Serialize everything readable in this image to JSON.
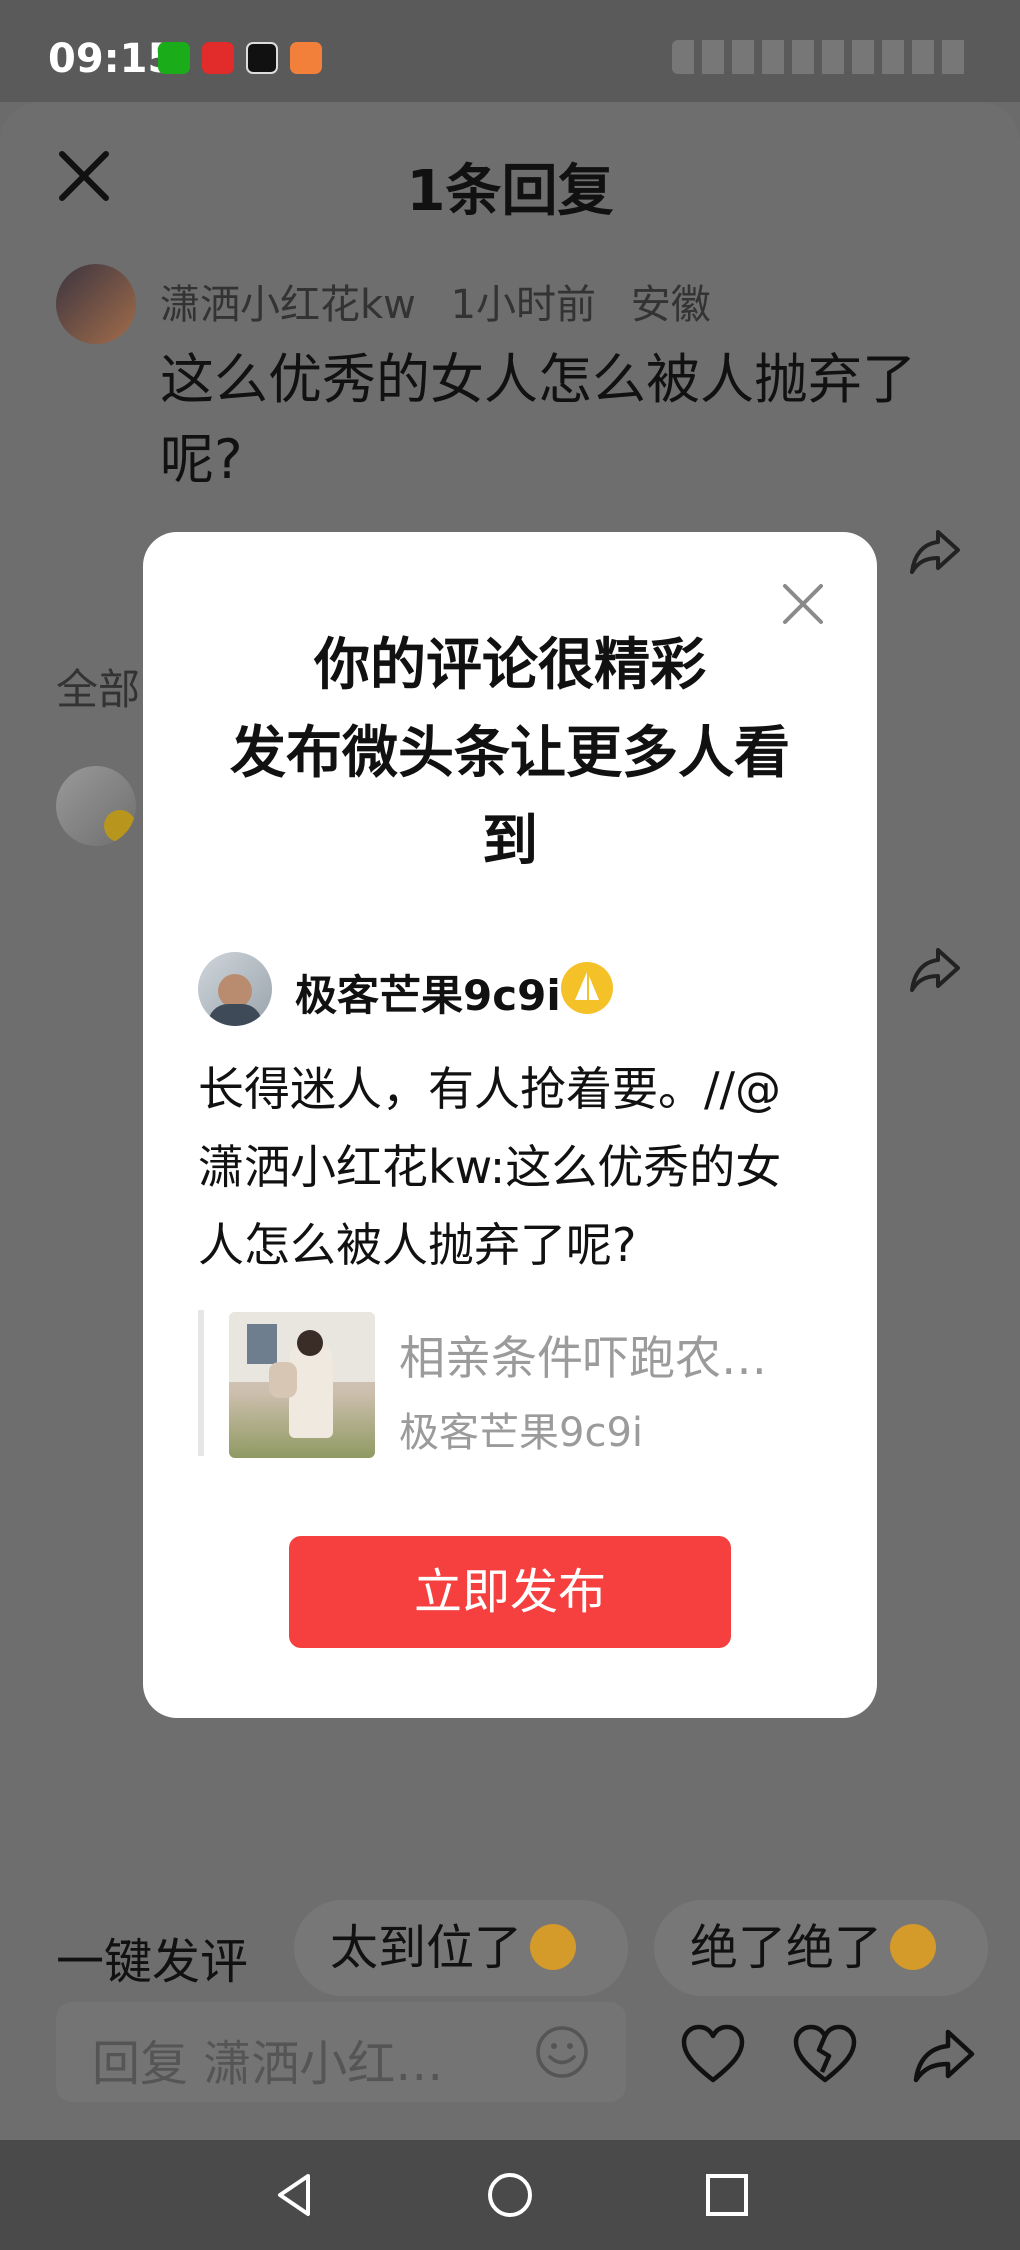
{
  "status_bar": {
    "time": "09:15",
    "apps": [
      {
        "name": "wechat-icon",
        "color": "#1aad19"
      },
      {
        "name": "huawei-icon",
        "color": "#e22b2b"
      },
      {
        "name": "capcut-icon",
        "color": "#111111"
      },
      {
        "name": "shop-icon",
        "color": "#f2803a"
      }
    ]
  },
  "sheet": {
    "title": "1条回复",
    "comment": {
      "author": "潇洒小红花kw",
      "time": "1小时前",
      "location": "安徽",
      "text": "这么优秀的女人怎么被人抛弃了呢?"
    },
    "all_label": "全部"
  },
  "modal": {
    "title_lines": [
      "你的评论很精彩",
      "发布微头条让更多人看",
      "到"
    ],
    "post": {
      "author": "极客芒果9c9i",
      "text": "长得迷人，有人抢着要。//@潇洒小红花kw:这么优秀的女人怎么被人抛弃了呢?",
      "quote_title": "相亲条件吓跑农…",
      "quote_author": "极客芒果9c9i"
    },
    "publish_label": "立即发布"
  },
  "bottom_bar": {
    "quick_label": "一键发评",
    "chips": [
      "太到位了",
      "绝了绝了"
    ],
    "reply_placeholder": "回复 潇洒小红…"
  },
  "colors": {
    "accent": "#f5403f",
    "overlay": "#6e6e6e"
  }
}
